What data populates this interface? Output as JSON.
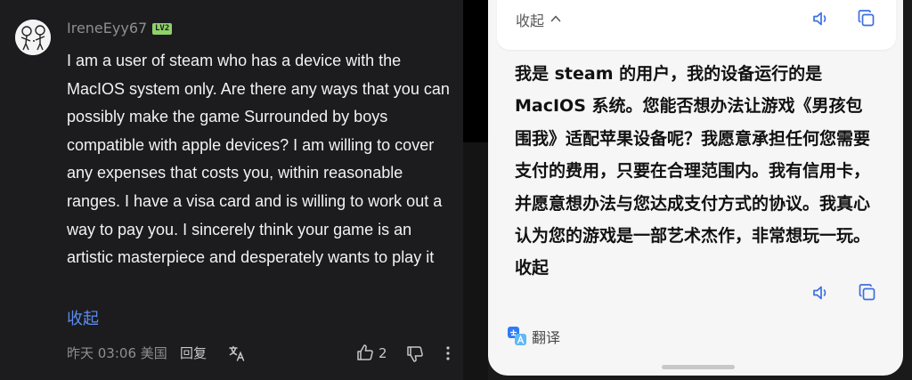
{
  "comment": {
    "username": "IreneEyy67",
    "level_badge": "LV2",
    "body": "I am a user of steam who has a device with the MacIOS system only. Are there any ways that you can possibly make the game Surrounded by boys compatible with apple devices? I am willing to cover any expenses that costs you, within reasonable ranges. I have a visa card and is willing to work out a way to pay you. I sincerely think your game is an artistic masterpiece and desperately wants to play it",
    "collapse_label": "收起",
    "time": "昨天 03:06 美国",
    "reply_label": "回复",
    "like_count": "2",
    "icons": {
      "translate": "translate-icon",
      "like": "thumbs-up-icon",
      "dislike": "thumbs-down-icon",
      "more": "more-vertical-icon"
    }
  },
  "translation": {
    "top_collapse_label": "收起",
    "text": "我是 steam 的用户，我的设备运行的是 MacIOS 系统。您能否想办法让游戏《男孩包围我》适配苹果设备呢？我愿意承担任何您需要支付的费用，只要在合理范围内。我有信用卡，并愿意想办法与您达成支付方式的协议。我真心认为您的游戏是一部艺术杰作，非常想玩一玩。",
    "inline_collapse_label": " 收起",
    "footer_label": "翻译",
    "icons": {
      "speaker": "speaker-icon",
      "copy": "copy-icon"
    }
  },
  "colors": {
    "link_blue": "#5b8cf0",
    "badge_green": "#8fd16a",
    "dark_bg": "#1c1c1e",
    "sheet_bg": "#f6f6f6"
  }
}
